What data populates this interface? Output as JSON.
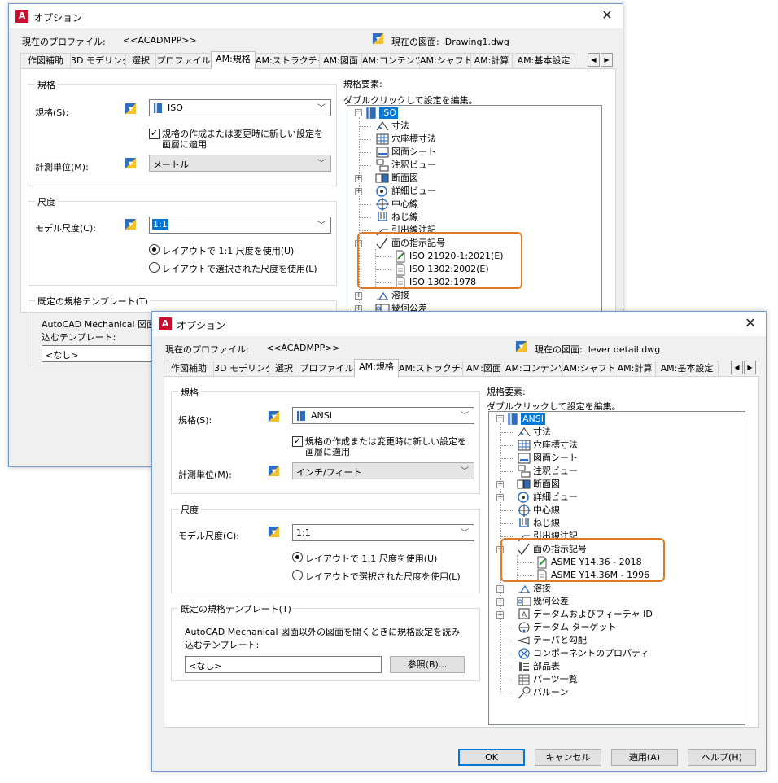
{
  "w1": {
    "title": "オプション",
    "profile_label": "現在のプロファイル:",
    "profile_value": "<<ACADMPP>>",
    "drawing_label": "現在の図面:",
    "drawing_value": "Drawing1.dwg",
    "tabs": [
      "作図補助",
      "3D モデリング",
      "選択",
      "プロファイル",
      "AM:規格",
      "AM:ストラクチャ",
      "AM:図面",
      "AM:コンテンツ",
      "AM:シャフト",
      "AM:計算",
      "AM:基本設定"
    ],
    "active_tab": "AM:規格",
    "standard_group": "規格",
    "standard_label": "規格(S):",
    "standard_value": "ISO",
    "checkbox_label_1": "規格の作成または変更時に新しい設定を",
    "checkbox_label_2": "画層に適用",
    "unit_label": "計測単位(M):",
    "unit_value": "メートル",
    "scale_group": "尺度",
    "model_scale_label": "モデル尺度(C):",
    "model_scale_value": "1:1",
    "radio1": "レイアウトで 1:1 尺度を使用(U)",
    "radio2": "レイアウトで選択された尺度を使用(L)",
    "template_group": "既定の規格テンプレート(T)",
    "template_desc_1": "AutoCAD Mechanical 図面",
    "template_desc_2": "込むテンプレート:",
    "template_value": "<なし>",
    "tree_title": "規格要素:",
    "tree_hint": "ダブルクリックして設定を編集。",
    "tree": [
      "ISO",
      "寸法",
      "穴座標寸法",
      "図面シート",
      "注釈ビュー",
      "断面図",
      "詳細ビュー",
      "中心線",
      "ねじ線",
      "引出線注記",
      "面の指示記号",
      "ISO 21920-1:2021(E)",
      "ISO 1302:2002(E)",
      "ISO 1302:1978",
      "溶接",
      "幾何公差"
    ]
  },
  "w2": {
    "title": "オプション",
    "profile_label": "現在のプロファイル:",
    "profile_value": "<<ACADMPP>>",
    "drawing_label": "現在の図面:",
    "drawing_value": "lever detail.dwg",
    "tabs": [
      "作図補助",
      "3D モデリング",
      "選択",
      "プロファイル",
      "AM:規格",
      "AM:ストラクチャ",
      "AM:図面",
      "AM:コンテンツ",
      "AM:シャフト",
      "AM:計算",
      "AM:基本設定"
    ],
    "active_tab": "AM:規格",
    "standard_group": "規格",
    "standard_label": "規格(S):",
    "standard_value": "ANSI",
    "checkbox_label_1": "規格の作成または変更時に新しい設定を",
    "checkbox_label_2": "画層に適用",
    "unit_label": "計測単位(M):",
    "unit_value": "インチ/フィート",
    "scale_group": "尺度",
    "model_scale_label": "モデル尺度(C):",
    "model_scale_value": "1:1",
    "radio1": "レイアウトで 1:1 尺度を使用(U)",
    "radio2": "レイアウトで選択された尺度を使用(L)",
    "template_group": "既定の規格テンプレート(T)",
    "template_desc_1": "AutoCAD Mechanical 図面以外の図面を開くときに規格設定を読み",
    "template_desc_2": "込むテンプレート:",
    "template_value": "<なし>",
    "browse_button": "参照(B)...",
    "tree_title": "規格要素:",
    "tree_hint": "ダブルクリックして設定を編集。",
    "tree": [
      "ANSI",
      "寸法",
      "穴座標寸法",
      "図面シート",
      "注釈ビュー",
      "断面図",
      "詳細ビュー",
      "中心線",
      "ねじ線",
      "引出線注記",
      "面の指示記号",
      "ASME Y14.36 - 2018",
      "ASME Y14.36M - 1996",
      "溶接",
      "幾何公差",
      "データムおよびフィーチャ ID",
      "データム ターゲット",
      "テーパと勾配",
      "コンポーネントのプロパティ",
      "部品表",
      "パーツ一覧",
      "バルーン"
    ],
    "buttons": [
      "OK",
      "キャンセル",
      "適用(A)",
      "ヘルプ(H)"
    ]
  },
  "colors": {
    "highlight_box": "#e07b24",
    "selection": "#0078d7",
    "window_border": "#6f9bd4"
  }
}
